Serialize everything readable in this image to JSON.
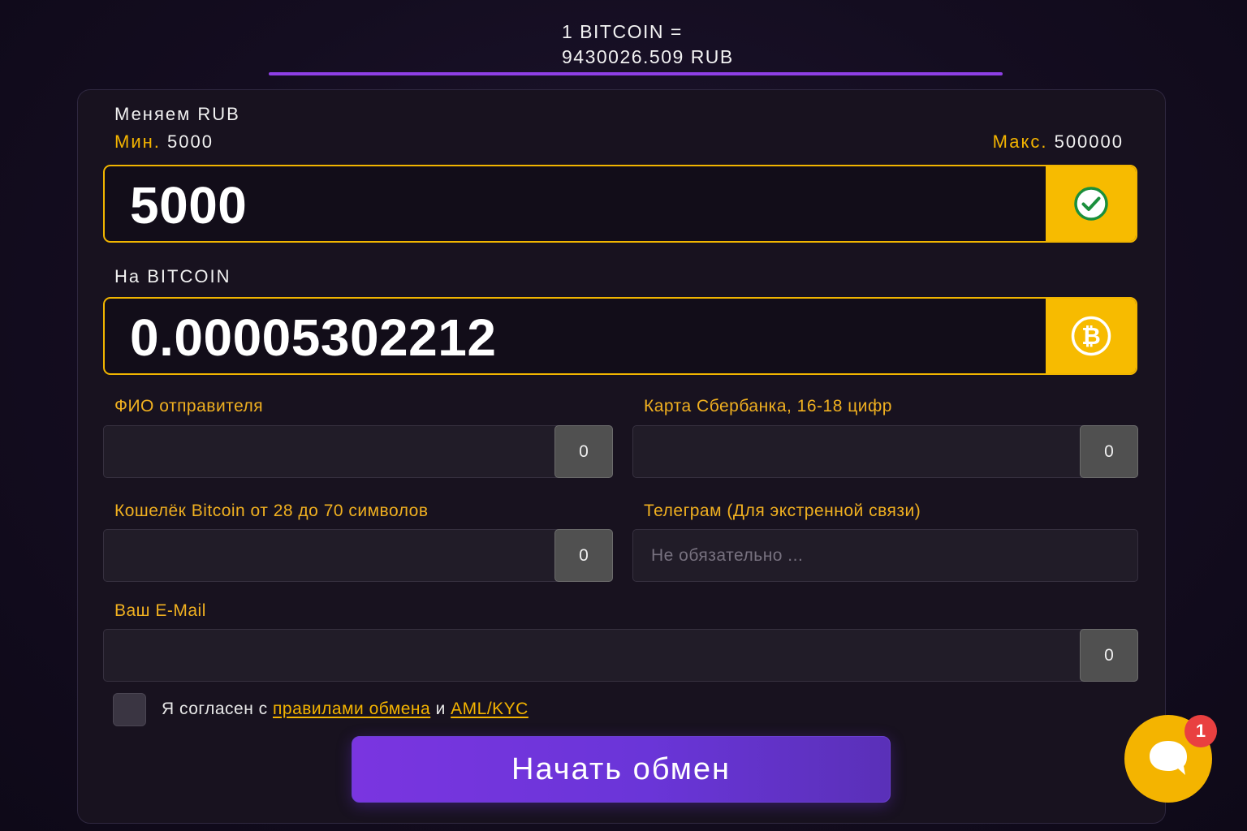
{
  "rate": {
    "line1": "1 BITCOIN =",
    "line2": "9430026.509 RUB"
  },
  "from": {
    "title": "Меняем RUB",
    "min_label": "Мин.",
    "min_value": "5000",
    "max_label": "Макс.",
    "max_value": "500000",
    "amount": "5000",
    "side_icon": "check-circle-icon"
  },
  "to": {
    "title": "На BITCOIN",
    "amount": "0.00005302212",
    "side_icon": "bitcoin-icon"
  },
  "fields": {
    "sender_name": {
      "label": "ФИО отправителя",
      "value": "",
      "counter": "0"
    },
    "card": {
      "label": "Карта Сбербанка, 16-18 цифр",
      "value": "",
      "counter": "0"
    },
    "wallet": {
      "label": "Кошелёк Bitcoin от 28 до 70 символов",
      "value": "",
      "counter": "0"
    },
    "telegram": {
      "label": "Телеграм (Для экстренной связи)",
      "value": "",
      "placeholder": "Не обязательно ..."
    },
    "email": {
      "label": "Ваш E-Mail",
      "value": "",
      "counter": "0"
    }
  },
  "agreement": {
    "checked": false,
    "prefix": "Я согласен с",
    "rules_link": "правилами обмена",
    "conjunction": "и",
    "aml_link": "AML/KYC"
  },
  "submit": {
    "label": "Начать обмен"
  },
  "chat": {
    "icon": "chat-bubble-icon",
    "badge": "1"
  },
  "colors": {
    "accent_gold": "#f7bb00",
    "accent_purple": "#7a35e0",
    "badge_red": "#e94040",
    "check_green": "#1a8f3c",
    "background": "#140d20"
  }
}
